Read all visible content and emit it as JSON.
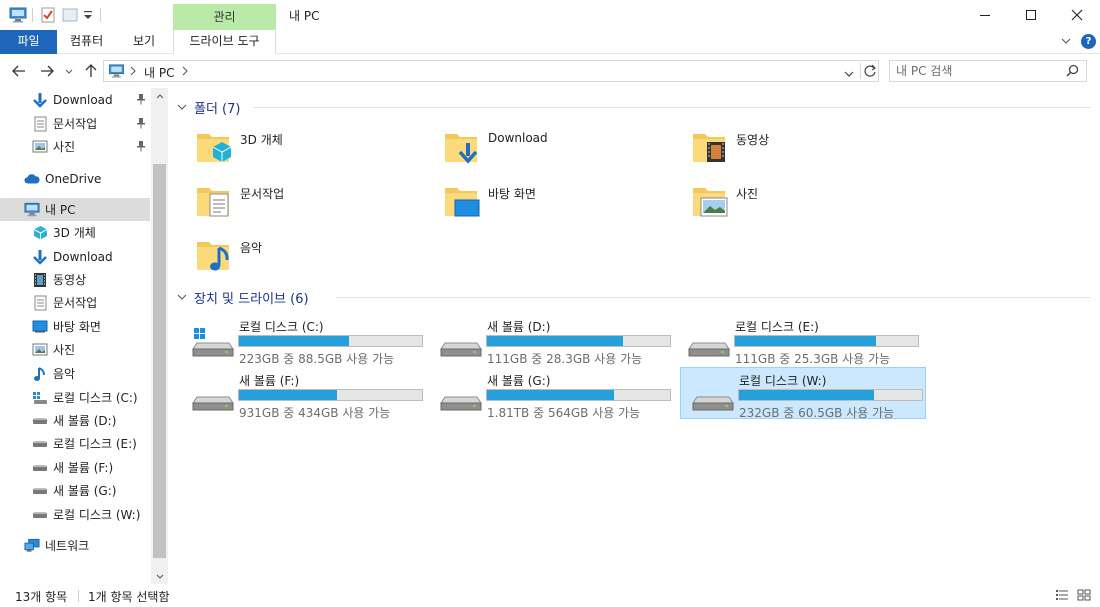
{
  "window": {
    "title": "내 PC",
    "context_tab_group": "관리"
  },
  "ribbon": {
    "tabs": [
      {
        "label": "파일",
        "active": true
      },
      {
        "label": "컴퓨터"
      },
      {
        "label": "보기"
      },
      {
        "label": "드라이브 도구"
      }
    ],
    "help": "?"
  },
  "address": {
    "crumbs": [
      "내 PC"
    ],
    "search_placeholder": "내 PC 검색"
  },
  "sidebar": {
    "items": [
      {
        "label": "Download",
        "icon": "download-arrow-icon",
        "pinned": true
      },
      {
        "label": "문서작업",
        "icon": "document-icon",
        "pinned": true
      },
      {
        "label": "사진",
        "icon": "picture-icon",
        "pinned": true
      },
      {
        "label": "OneDrive",
        "icon": "cloud-icon"
      },
      {
        "label": "내 PC",
        "icon": "computer-icon",
        "selected": true
      },
      {
        "label": "3D 개체",
        "icon": "cube-icon"
      },
      {
        "label": "Download",
        "icon": "download-arrow-icon"
      },
      {
        "label": "동영상",
        "icon": "film-icon"
      },
      {
        "label": "문서작업",
        "icon": "document-icon"
      },
      {
        "label": "바탕 화면",
        "icon": "desktop-icon"
      },
      {
        "label": "사진",
        "icon": "picture-icon"
      },
      {
        "label": "음악",
        "icon": "music-note-icon"
      },
      {
        "label": "로컬 디스크 (C:)",
        "icon": "windows-drive-icon"
      },
      {
        "label": "새 볼륨 (D:)",
        "icon": "drive-icon"
      },
      {
        "label": "로컬 디스크 (E:)",
        "icon": "drive-icon"
      },
      {
        "label": "새 볼륨 (F:)",
        "icon": "drive-icon"
      },
      {
        "label": "새 볼륨 (G:)",
        "icon": "drive-icon"
      },
      {
        "label": "로컬 디스크 (W:)",
        "icon": "drive-icon"
      },
      {
        "label": "네트워크",
        "icon": "network-icon"
      }
    ]
  },
  "folders": {
    "title": "폴더 (7)",
    "items": [
      {
        "label": "3D 개체",
        "icon": "cube-icon"
      },
      {
        "label": "Download",
        "icon": "download-arrow-icon"
      },
      {
        "label": "동영상",
        "icon": "film-icon"
      },
      {
        "label": "문서작업",
        "icon": "document-icon"
      },
      {
        "label": "바탕 화면",
        "icon": "desktop-icon"
      },
      {
        "label": "사진",
        "icon": "picture-icon"
      },
      {
        "label": "음악",
        "icon": "music-note-icon"
      }
    ]
  },
  "drives": {
    "title": "장치 및 드라이브 (6)",
    "items": [
      {
        "label": "로컬 디스크 (C:)",
        "free_text": "223GB 중 88.5GB 사용 가능",
        "used_fraction": 0.6,
        "windows": true
      },
      {
        "label": "새 볼륨 (D:)",
        "free_text": "111GB 중 28.3GB 사용 가능",
        "used_fraction": 0.745
      },
      {
        "label": "로컬 디스크 (E:)",
        "free_text": "111GB 중 25.3GB 사용 가능",
        "used_fraction": 0.772
      },
      {
        "label": "새 볼륨 (F:)",
        "free_text": "931GB 중 434GB 사용 가능",
        "used_fraction": 0.534
      },
      {
        "label": "새 볼륨 (G:)",
        "free_text": "1.81TB 중 564GB 사용 가능",
        "used_fraction": 0.696
      },
      {
        "label": "로컬 디스크 (W:)",
        "free_text": "232GB 중 60.5GB 사용 가능",
        "used_fraction": 0.739,
        "selected": true
      }
    ]
  },
  "status": {
    "count": "13개 항목",
    "selection": "1개 항목 선택함"
  },
  "colors": {
    "accent": "#1e66b9",
    "bar_fill": "#26a0da",
    "selection": "#cce8ff",
    "context_tab": "#b9eaa8",
    "group_title": "#1e3287"
  }
}
